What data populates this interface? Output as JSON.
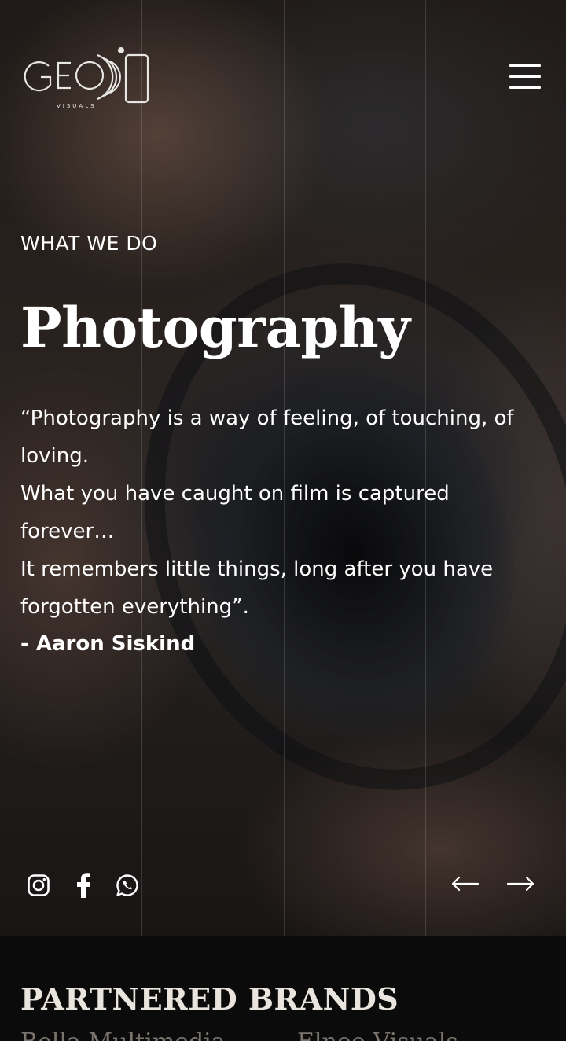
{
  "header": {
    "logo_text": "GEO",
    "logo_subtext": "VISUALS",
    "menu_icon": "hamburger-menu-icon"
  },
  "hero": {
    "eyebrow": "WHAT WE DO",
    "title": "Photography",
    "quote_lines": [
      "“Photography is a way of feeling, of touching, of",
      "loving.",
      "What you have caught on film is captured",
      "forever…",
      "It remembers little things, long after you have",
      "forgotten everything”."
    ],
    "author": "- Aaron Siskind"
  },
  "social": {
    "icons": [
      "instagram-icon",
      "facebook-icon",
      "whatsapp-icon"
    ]
  },
  "slider": {
    "prev_icon": "arrow-left-icon",
    "next_icon": "arrow-right-icon"
  },
  "brands": {
    "title": "PARTNERED BRANDS",
    "items": [
      "Bella Multimedia",
      "Elnoo Visuals"
    ]
  },
  "colors": {
    "background_dark": "#0b0b0b",
    "text_primary": "#ffffff",
    "brand_title": "#e9e4dd",
    "brand_item": "#7a746e"
  }
}
